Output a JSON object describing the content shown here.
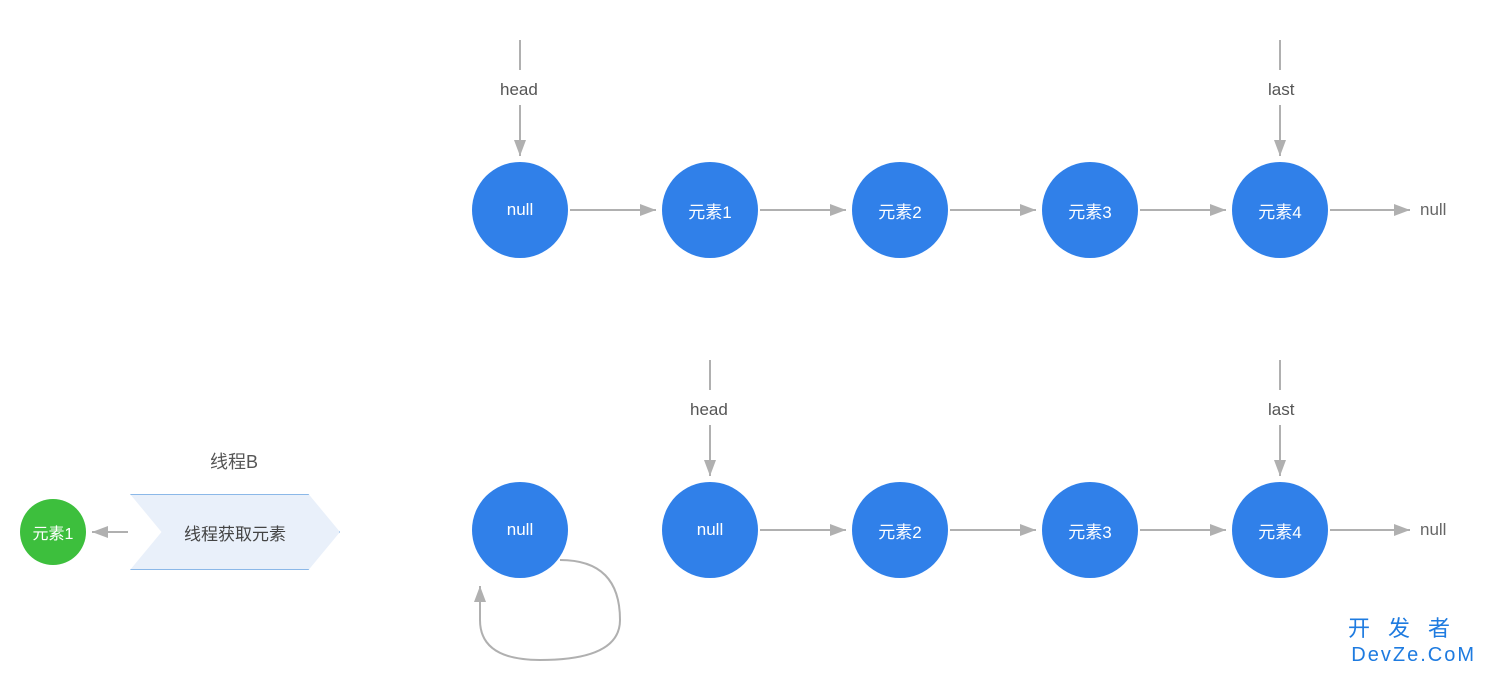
{
  "row1": {
    "head_label": "head",
    "last_label": "last",
    "nodes": [
      "null",
      "元素1",
      "元素2",
      "元素3",
      "元素4"
    ],
    "tail": "null"
  },
  "row2": {
    "head_label": "head",
    "last_label": "last",
    "detached": "null",
    "nodes": [
      "null",
      "元素2",
      "元素3",
      "元素4"
    ],
    "tail": "null"
  },
  "threadB": {
    "title": "线程B",
    "result": "元素1",
    "action": "线程获取元素"
  },
  "watermark": {
    "line1": "开发者",
    "line2": "DevZe.CoM"
  },
  "colors": {
    "node_blue": "#3080E9",
    "node_green": "#3DBF3D",
    "arrow": "#b0b0b0",
    "chevron_fill": "#e9f0fa",
    "chevron_border": "#8bb8e8"
  }
}
